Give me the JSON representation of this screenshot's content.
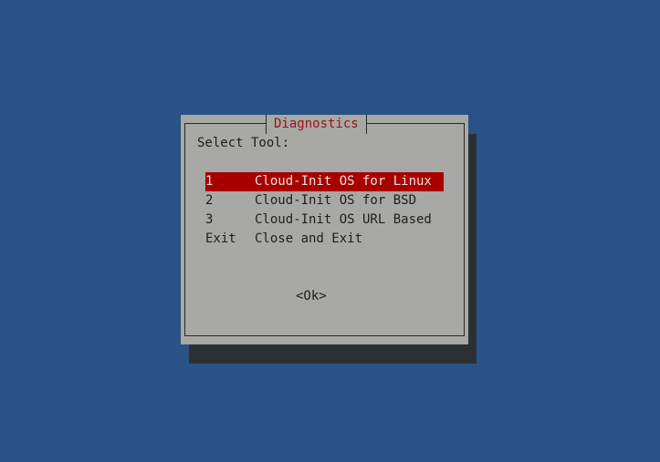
{
  "dialog": {
    "title": "Diagnostics",
    "prompt": "Select Tool:",
    "items": [
      {
        "tag": "1",
        "label": "Cloud-Init OS for Linux",
        "selected": true
      },
      {
        "tag": "2",
        "label": "Cloud-Init OS for BSD",
        "selected": false
      },
      {
        "tag": "3",
        "label": "Cloud-Init OS URL Based",
        "selected": false
      },
      {
        "tag": "Exit",
        "label": "Close and Exit",
        "selected": false
      }
    ],
    "ok_label": "<Ok>"
  },
  "colors": {
    "background": "#2a5286",
    "dialog": "#a8a8a4",
    "shadow": "#2c2f33",
    "title": "#9b1313",
    "selection": "#a80000"
  }
}
